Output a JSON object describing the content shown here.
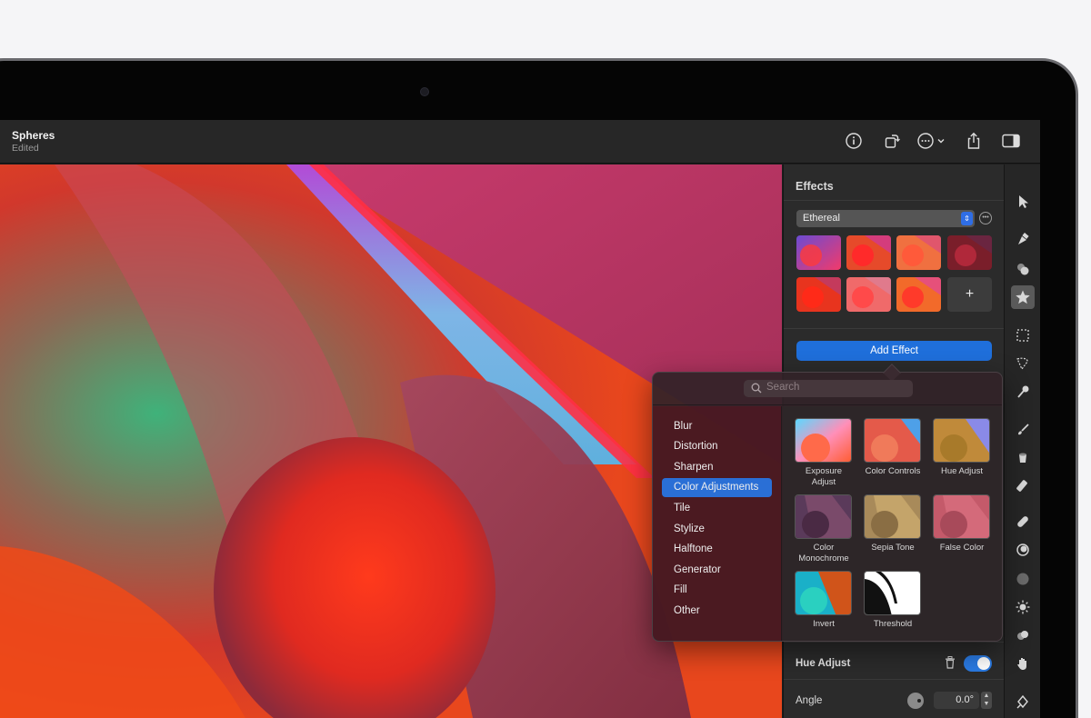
{
  "document": {
    "title": "Spheres",
    "subtitle": "Edited"
  },
  "toolbar": {
    "icons": [
      "info-icon",
      "rotate-icon",
      "more-options-icon",
      "share-icon",
      "sidebar-icon"
    ]
  },
  "effects_panel": {
    "title": "Effects",
    "preset": "Ethereal",
    "add_effect_label": "Add Effect",
    "add_preset_label": "+",
    "active_effect": {
      "name": "Hue Adjust",
      "enabled": true,
      "angle_label": "Angle",
      "angle_value": "0.0°"
    }
  },
  "popover": {
    "search_placeholder": "Search",
    "categories": [
      "Blur",
      "Distortion",
      "Sharpen",
      "Color Adjustments",
      "Tile",
      "Stylize",
      "Halftone",
      "Generator",
      "Fill",
      "Other"
    ],
    "selected_category": "Color Adjustments",
    "effects": [
      "Exposure Adjust",
      "Color Controls",
      "Hue Adjust",
      "Color Monochrome",
      "Sepia Tone",
      "False Color",
      "Invert",
      "Threshold"
    ]
  },
  "tools": [
    "arrow-icon",
    "pen-tool-icon",
    "shapes-icon",
    "effects-star-icon",
    "marquee-select-icon",
    "lasso-icon",
    "magic-wand-icon",
    "brush-icon",
    "paint-bucket-icon",
    "eraser-icon",
    "bandage-icon",
    "clone-icon",
    "blur-icon",
    "brightness-icon",
    "smudge-icon",
    "hand-icon",
    "pen-nib-icon"
  ],
  "colors": {
    "accent": "#2a6fd6",
    "panel": "#2b2b2b",
    "titlebar": "#272727"
  }
}
